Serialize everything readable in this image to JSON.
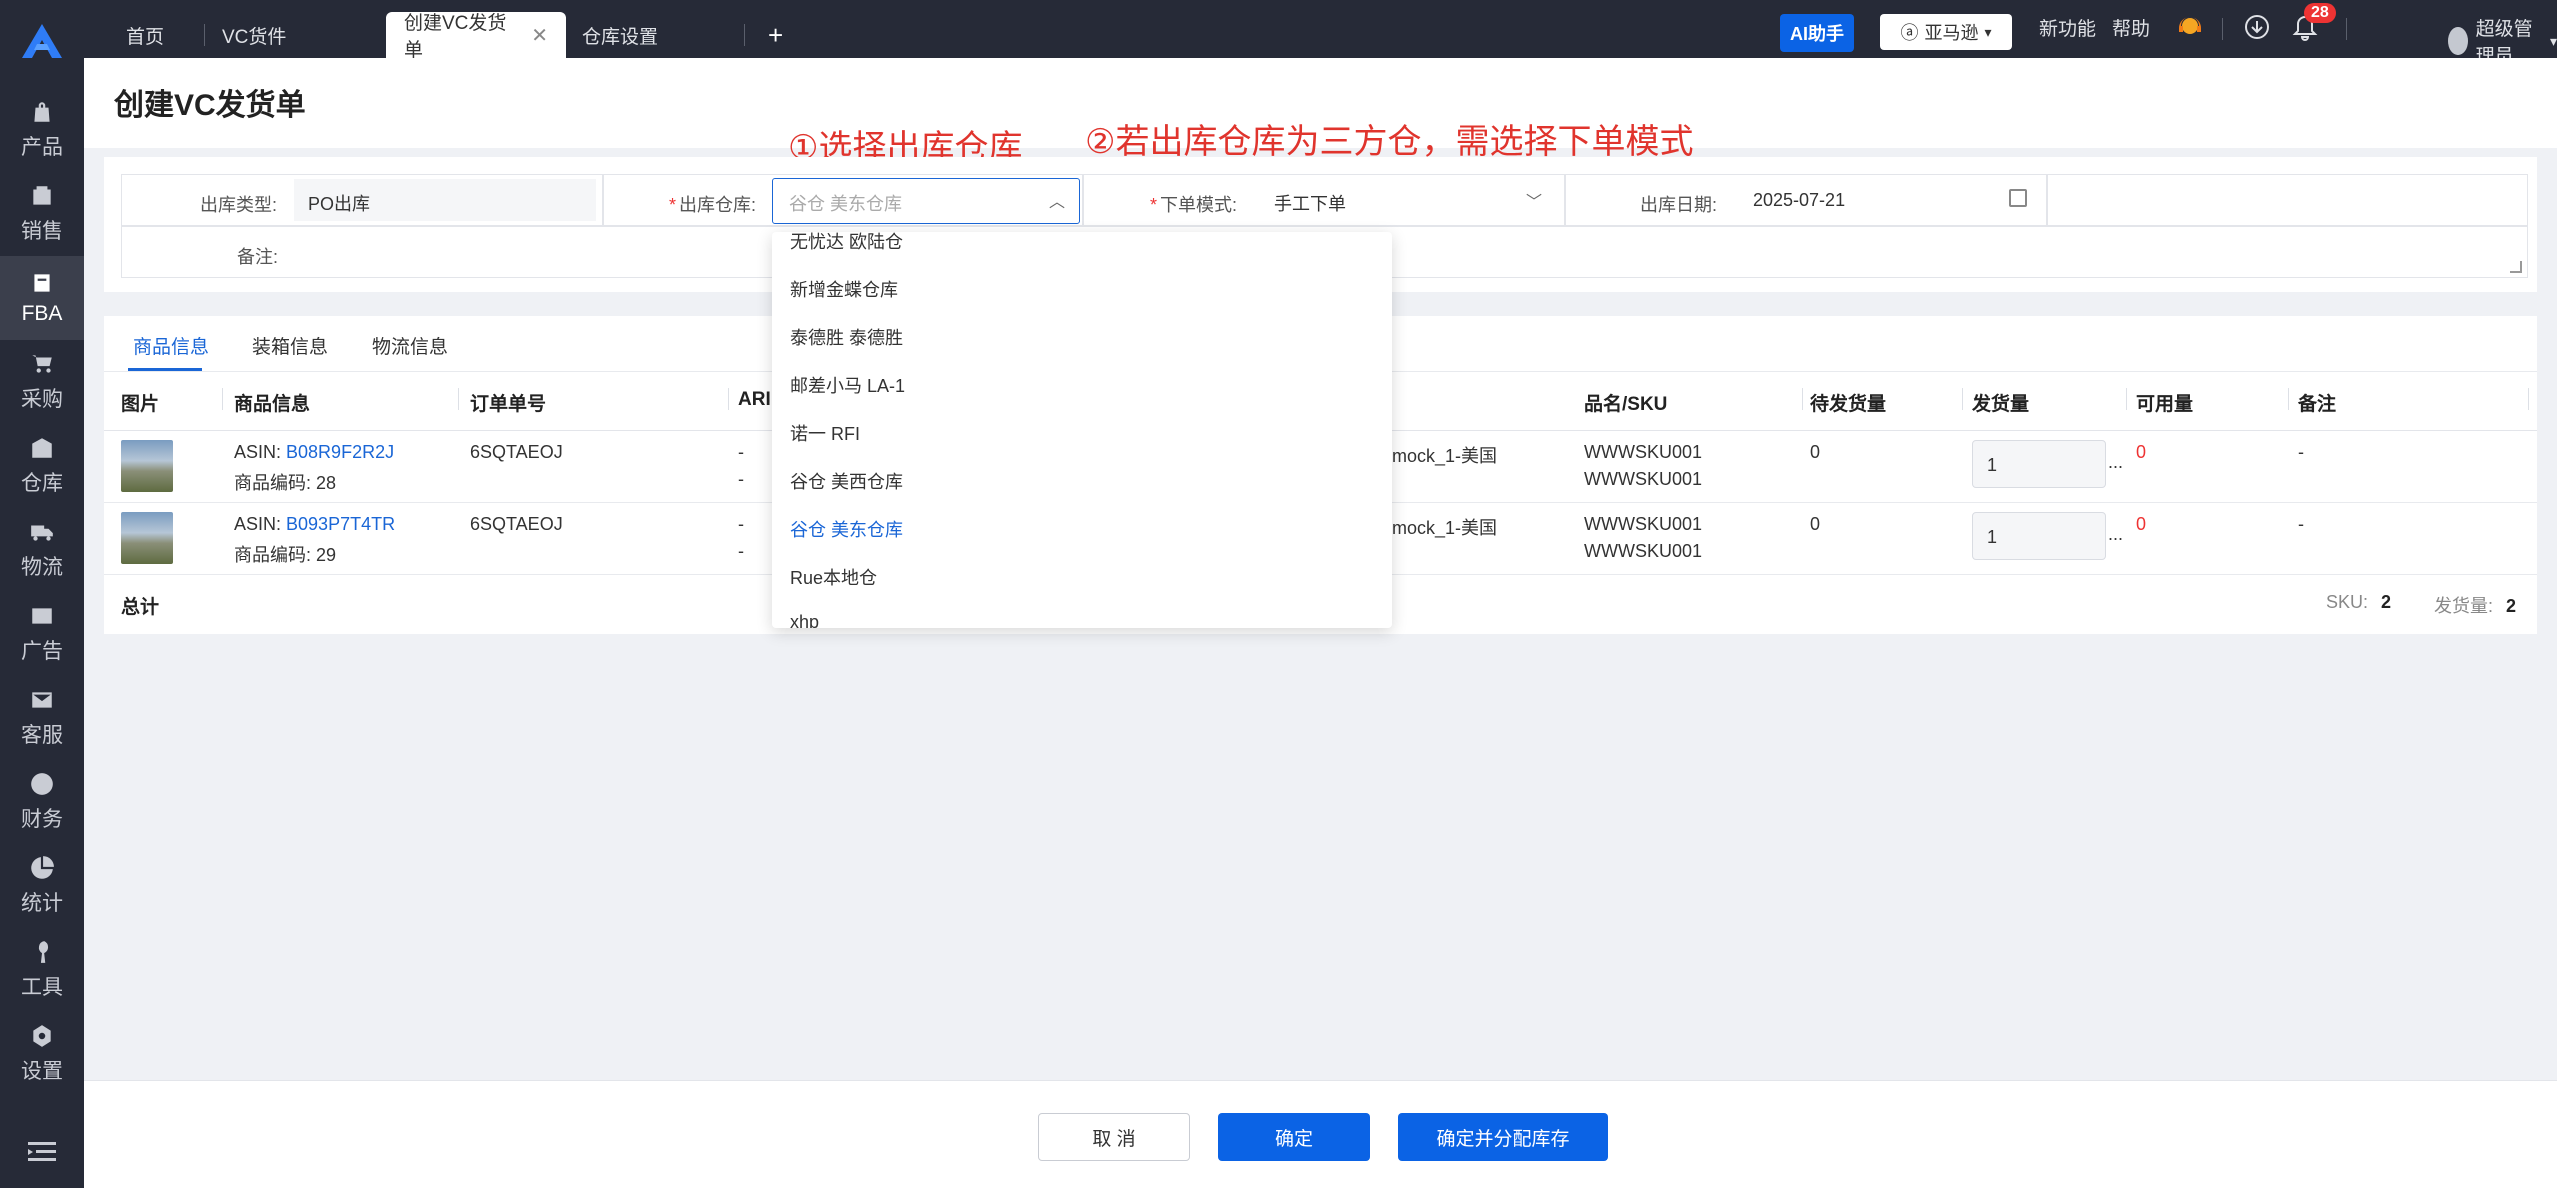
{
  "sidebar": {
    "items": [
      {
        "label": "产品",
        "icon": "bag-icon"
      },
      {
        "label": "销售",
        "icon": "sales-icon"
      },
      {
        "label": "FBA",
        "icon": "fba-icon"
      },
      {
        "label": "采购",
        "icon": "cart-icon"
      },
      {
        "label": "仓库",
        "icon": "warehouse-icon"
      },
      {
        "label": "物流",
        "icon": "truck-icon"
      },
      {
        "label": "广告",
        "icon": "ad-icon"
      },
      {
        "label": "客服",
        "icon": "mail-icon"
      },
      {
        "label": "财务",
        "icon": "yen-icon"
      },
      {
        "label": "统计",
        "icon": "pie-icon"
      },
      {
        "label": "工具",
        "icon": "tool-icon"
      },
      {
        "label": "设置",
        "icon": "gear-icon"
      }
    ],
    "active": "FBA"
  },
  "topbar": {
    "tabs": [
      "首页",
      "VC货件",
      "创建VC发货单",
      "仓库设置"
    ],
    "active_tab": "创建VC发货单",
    "ai_label": "AI助手",
    "store_label": "亚马逊",
    "new_feature": "新功能",
    "help": "帮助",
    "notification_count": "28",
    "user": "超级管理员"
  },
  "page": {
    "title": "创建VC发货单"
  },
  "annotations": {
    "step1": "①选择出库仓库",
    "step2": "②若出库仓库为三方仓，需选择下单模式"
  },
  "form": {
    "type_label": "出库类型:",
    "type_value": "PO出库",
    "warehouse_label": "出库仓库:",
    "warehouse_value": "谷仓 美东仓库",
    "mode_label": "下单模式:",
    "mode_value": "手工下单",
    "date_label": "出库日期:",
    "date_value": "2025-07-21",
    "remark_label": "备注:"
  },
  "dropdown": {
    "options": [
      "无忧达 欧陆仓",
      "新增金蝶仓库",
      "泰德胜 泰德胜",
      "邮差小马 LA-1",
      "诺一 RFI",
      "谷仓 美西仓库",
      "谷仓 美东仓库",
      "Rue本地仓",
      "xhp"
    ],
    "selected": "谷仓 美东仓库"
  },
  "detail_tabs": [
    "商品信息",
    "装箱信息",
    "物流信息"
  ],
  "table": {
    "headers": [
      "图片",
      "商品信息",
      "订单单号",
      "ARI",
      "品名/SKU",
      "待发货量",
      "发货量",
      "可用量",
      "备注"
    ],
    "rows": [
      {
        "asin_label": "ASIN:",
        "asin": "B08R9F2R2J",
        "code": "商品编码: 28",
        "order": "6SQTAEOJ",
        "ari1": "-",
        "ari2": "-",
        "shop": "mock_1-美国",
        "sku1": "WWWSKU001",
        "sku2": "WWWSKU001",
        "pending": "0",
        "qty": "1",
        "avail": "0",
        "remark": "-"
      },
      {
        "asin_label": "ASIN:",
        "asin": "B093P7T4TR",
        "code": "商品编码: 29",
        "order": "6SQTAEOJ",
        "ari1": "-",
        "ari2": "-",
        "shop": "mock_1-美国",
        "sku1": "WWWSKU001",
        "sku2": "WWWSKU001",
        "pending": "0",
        "qty": "1",
        "avail": "0",
        "remark": "-"
      }
    ],
    "total_label": "总计",
    "sku_label": "SKU:",
    "sku_count": "2",
    "ship_label": "发货量:",
    "ship_count": "2"
  },
  "footer": {
    "cancel": "取 消",
    "confirm": "确定",
    "confirm_allocate": "确定并分配库存"
  },
  "colors": {
    "primary": "#0b63e5",
    "sidebar": "#262a37",
    "annotation": "#e0342d",
    "link": "#1a66d6"
  }
}
